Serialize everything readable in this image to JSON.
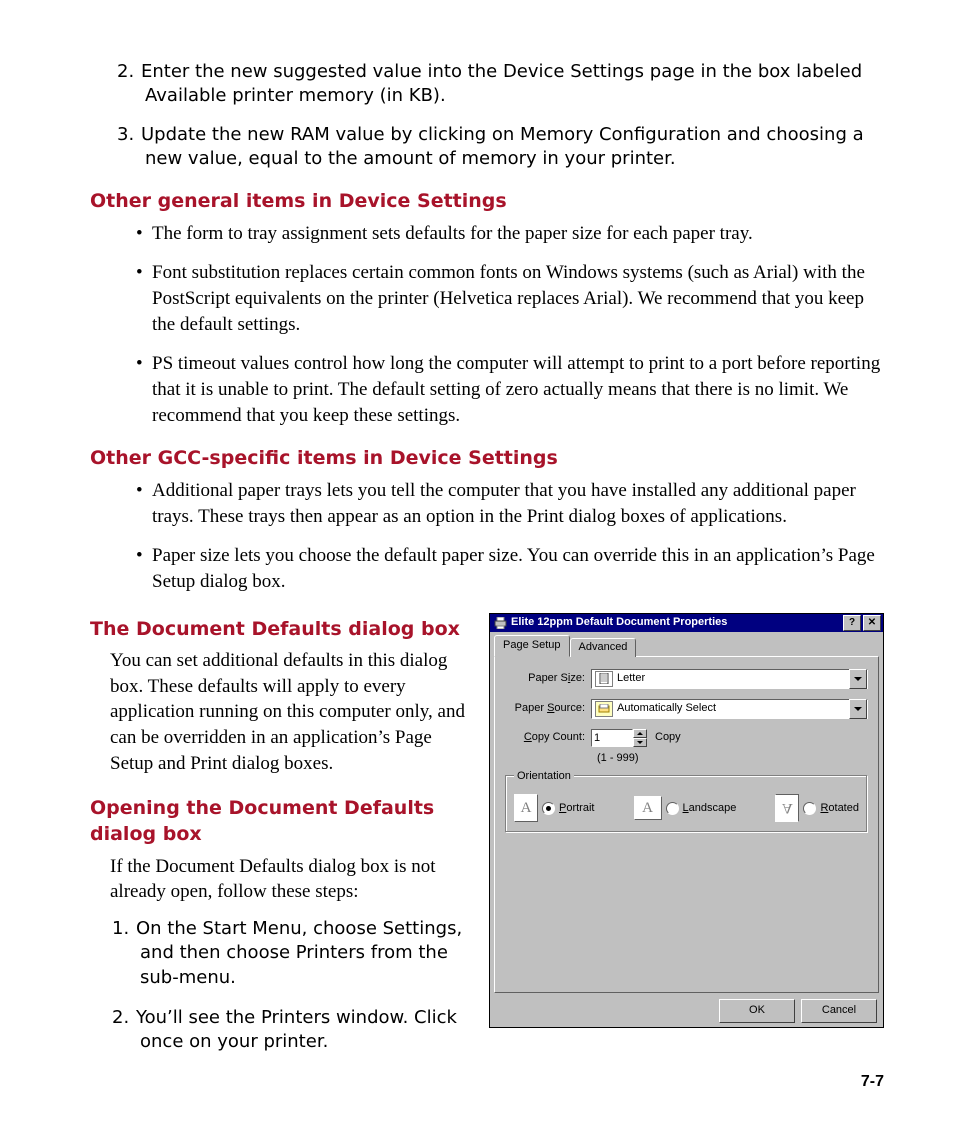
{
  "steps_top": [
    "Enter the new suggested value into the Device Settings page in the box labeled Available printer memory (in KB).",
    "Update the new RAM value by clicking on Memory Configuration and choosing a new value, equal to the amount of memory in your printer."
  ],
  "steps_top_start": 2,
  "heading_general": "Other general items in Device Settings",
  "bullets_general": [
    "The form to tray assignment sets defaults for the paper size for each paper tray.",
    "Font substitution replaces certain common fonts on Windows systems (such as Arial) with the PostScript equivalents on the printer (Helvetica replaces Arial). We recommend that you keep the default settings.",
    "PS timeout values control how long the computer will attempt to print to a port before reporting that it is unable to print. The default setting of zero actually means that there is no limit. We recommend that you keep these settings."
  ],
  "heading_gcc": "Other GCC-specific items in Device Settings",
  "bullets_gcc": [
    "Additional paper trays lets you tell the computer that you have installed any additional paper trays. These trays then appear as an option in the Print dialog boxes of applications.",
    "Paper size lets you choose the default paper size. You can override this in an application’s Page Setup dialog box."
  ],
  "heading_docdef": "The Document Defaults dialog box",
  "body_docdef": "You can set additional defaults in this dialog box. These defaults will apply to every application running on this computer only, and can be overridden in an application’s Page Setup and Print dialog boxes.",
  "heading_open": "Opening the Document Defaults dialog box",
  "body_open": "If the Document Defaults dialog box is not already open, follow these steps:",
  "steps_open": [
    "On the Start Menu, choose Settings, and then choose Printers from the sub-menu.",
    "You’ll see the Printers window. Click once on your printer."
  ],
  "dialog": {
    "title": "Elite 12ppm Default Document Properties",
    "help_label": "?",
    "close_label": "✕",
    "tabs": {
      "page_setup": "Page Setup",
      "advanced": "Advanced"
    },
    "paper_size_label": "Paper Size:",
    "paper_size_u": "i",
    "paper_size_value": "Letter",
    "paper_source_label": "Paper Source:",
    "paper_source_u": "S",
    "paper_source_value": "Automatically Select",
    "copy_count_label": "Copy Count:",
    "copy_count_u": "C",
    "copy_count_value": "1",
    "copy_word": "Copy",
    "copy_range": "(1 - 999)",
    "orientation_label": "Orientation",
    "portrait_label": "Portrait",
    "portrait_u": "P",
    "landscape_label": "Landscape",
    "landscape_u": "L",
    "rotated_label": "Rotated",
    "rotated_u": "R",
    "ok": "OK",
    "cancel": "Cancel"
  },
  "page_number": "7-7"
}
